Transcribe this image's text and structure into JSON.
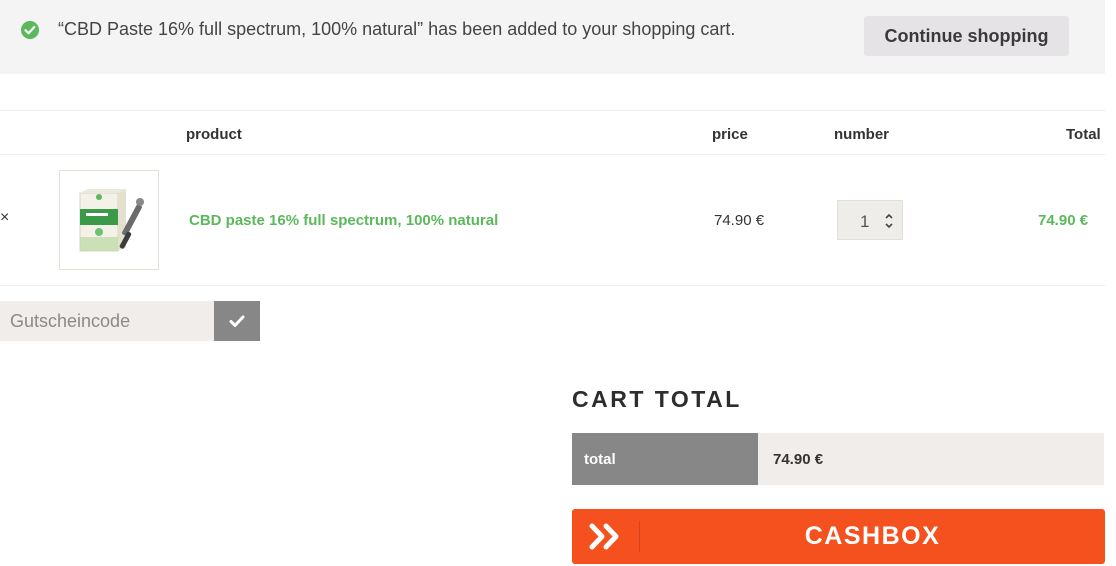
{
  "notice": {
    "message": "“CBD Paste 16% full spectrum, 100% natural” has been added to your shopping cart.",
    "continue_label": "Continue shopping",
    "icon": "check-circle-icon",
    "icon_color": "#5cb85c"
  },
  "table": {
    "headers": {
      "product": "product",
      "price": "price",
      "number": "number",
      "total": "Total"
    },
    "rows": [
      {
        "remove": "×",
        "image": "cbd-paste-product-image",
        "name": "CBD paste 16% full spectrum, 100% natural",
        "price": "74.90 €",
        "quantity": "1",
        "total": "74.90 €"
      }
    ]
  },
  "coupon": {
    "placeholder": "Gutscheincode",
    "apply_icon": "checkmark-icon"
  },
  "cart_total": {
    "title": "CART TOTAL",
    "total_label": "total",
    "total_value": "74.90 €",
    "checkout_label": "CASHBOX",
    "checkout_icon": "double-chevron-right-icon",
    "checkout_color": "#f4511e"
  },
  "colors": {
    "accent_green": "#5cb85c",
    "button_gray": "#878787",
    "field_bg": "#f0edea"
  }
}
